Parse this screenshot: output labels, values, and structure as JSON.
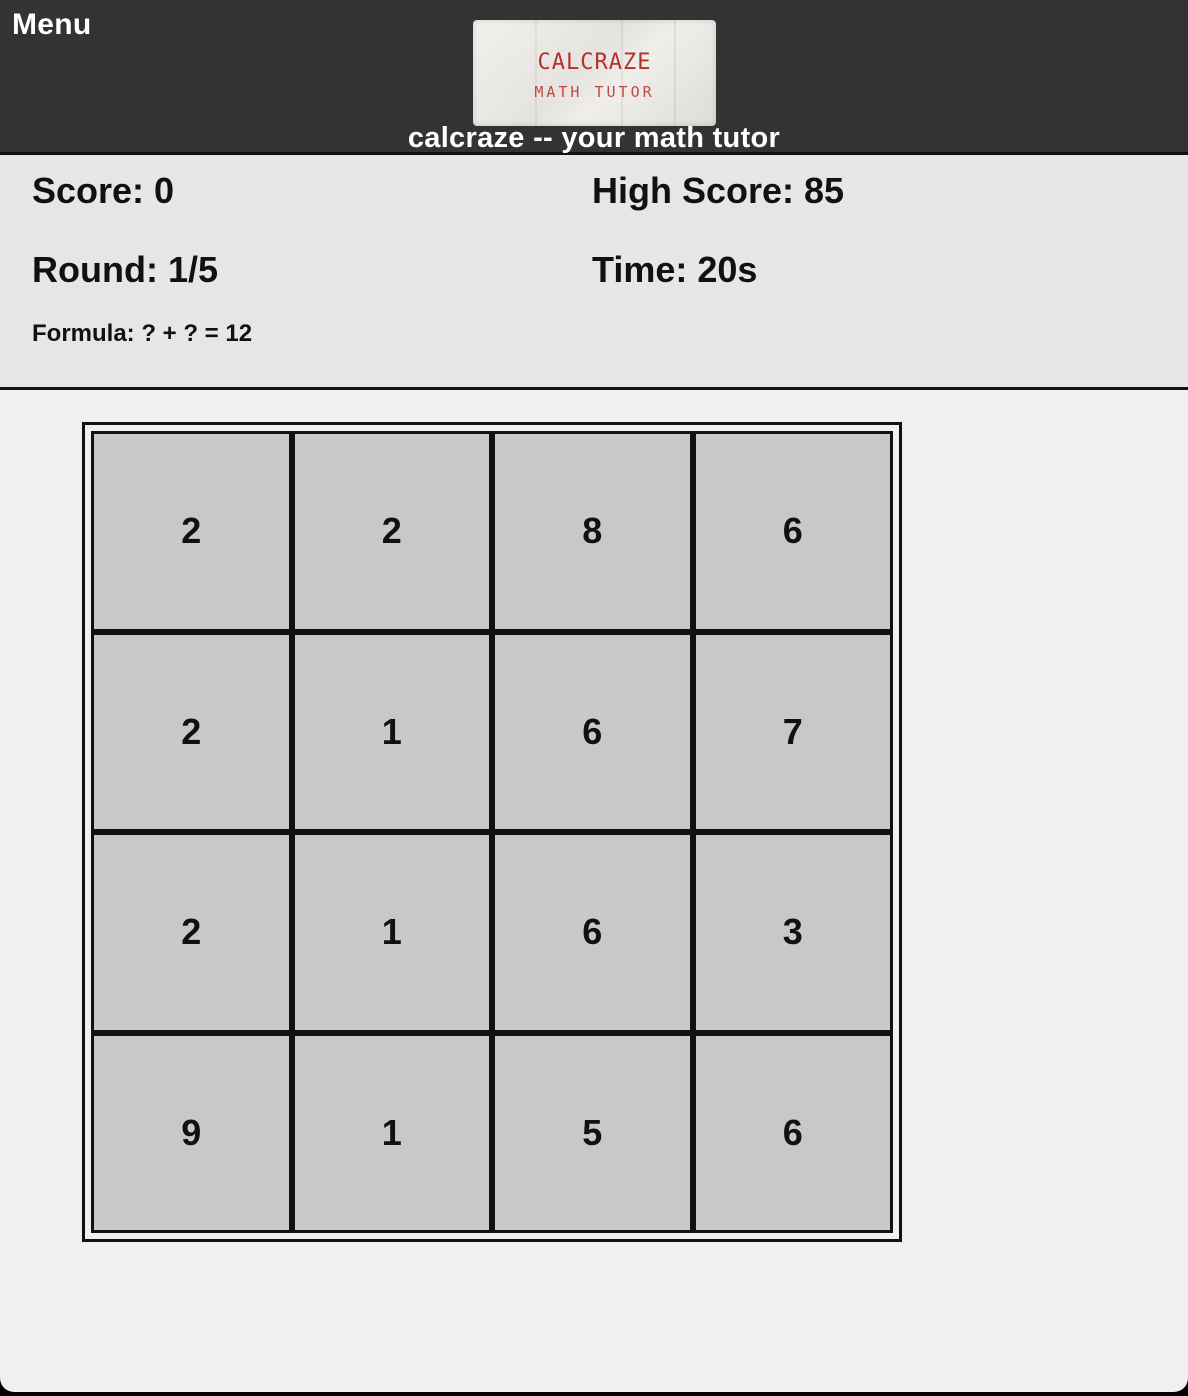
{
  "header": {
    "menu_label": "Menu",
    "logo_line1": "CALCRAZE",
    "logo_line2": "MATH TUTOR",
    "tagline": "calcraze -- your math tutor"
  },
  "stats": {
    "score": "Score: 0",
    "high_score": "High Score: 85",
    "round": "Round: 1/5",
    "time": "Time: 20s",
    "formula": "Formula: ? + ? = 12"
  },
  "board": {
    "cells": [
      [
        "2",
        "2",
        "8",
        "6"
      ],
      [
        "2",
        "1",
        "6",
        "7"
      ],
      [
        "2",
        "1",
        "6",
        "3"
      ],
      [
        "9",
        "1",
        "5",
        "6"
      ]
    ]
  },
  "colors": {
    "header_bg": "#333333",
    "stats_bg": "#e6e6e6",
    "cell_bg": "#c8c8c8",
    "grid_lines": "#111111",
    "logo_ink": "#b8302a"
  }
}
